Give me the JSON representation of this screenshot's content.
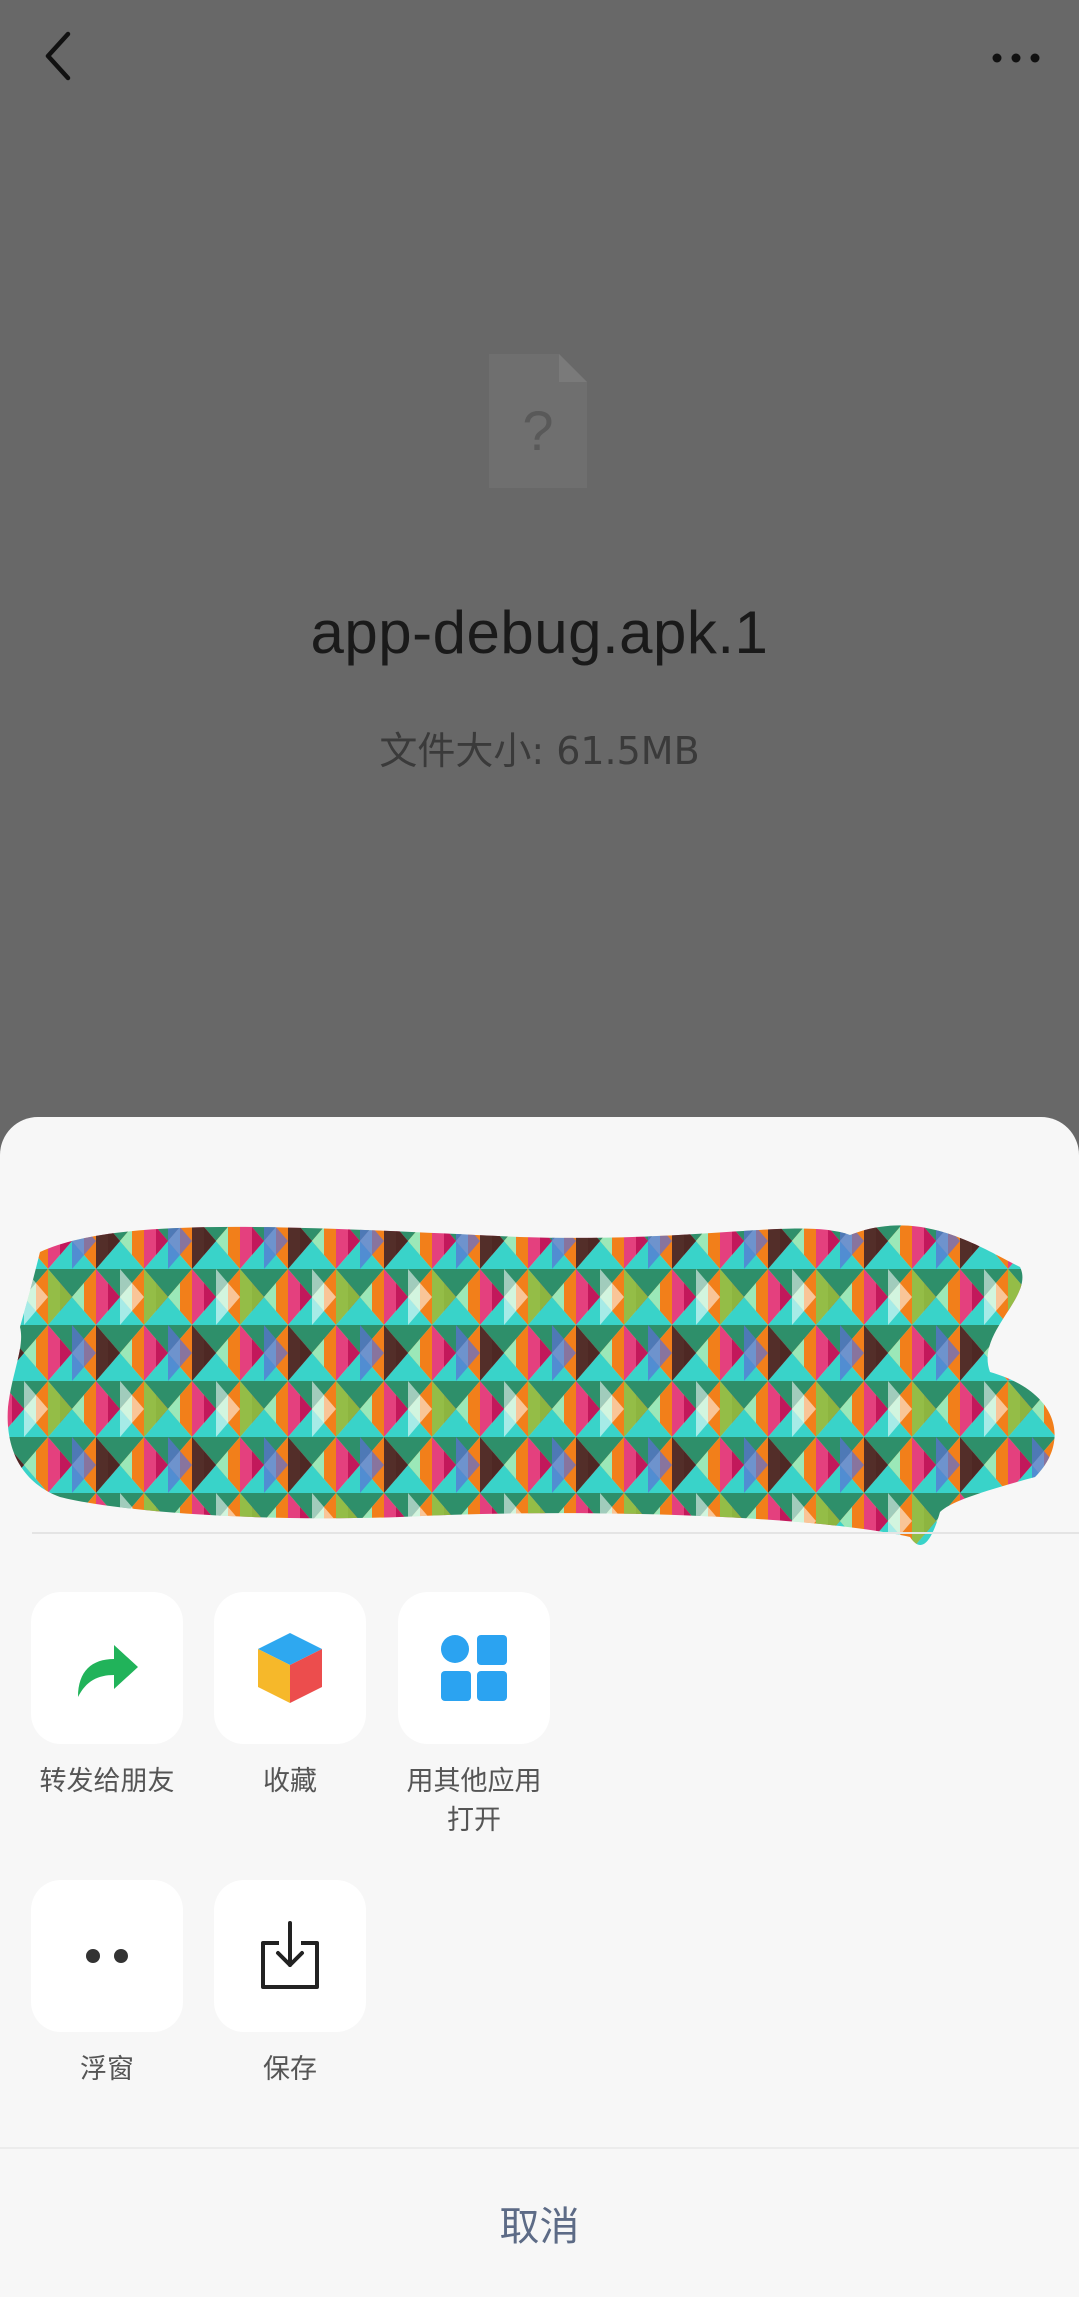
{
  "topbar": {
    "back_icon": "chevron-left-icon",
    "more_icon": "more-horizontal-icon"
  },
  "file": {
    "icon": "unknown-file-icon",
    "icon_glyph": "?",
    "name": "app-debug.apk.1",
    "size_text": "文件大小: 61.5MB"
  },
  "sheet": {
    "actions": [
      {
        "label": "转发给朋友",
        "icon": "forward-arrow-icon",
        "color": "#21b35a"
      },
      {
        "label": "收藏",
        "icon": "favorites-cube-icon",
        "colors": [
          "#2ea8f0",
          "#f6b82a",
          "#ec4d4d"
        ]
      },
      {
        "label": "用其他应用打开",
        "icon": "apps-grid-icon",
        "color": "#2ba3f1"
      },
      {
        "label": "浮窗",
        "icon": "floating-window-icon",
        "color": "#333333"
      },
      {
        "label": "保存",
        "icon": "save-download-icon",
        "color": "#222222"
      }
    ],
    "cancel_label": "取消"
  },
  "colors": {
    "dim_overlay": "#686868",
    "sheet_bg": "#f7f7f7",
    "tile_bg": "#ffffff",
    "cancel_text": "#5d6b86"
  }
}
